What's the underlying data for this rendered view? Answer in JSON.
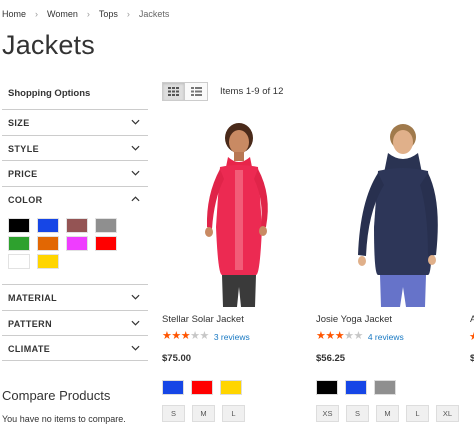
{
  "breadcrumb": {
    "items": [
      "Home",
      "Women",
      "Tops"
    ],
    "current": "Jackets",
    "separator": "›"
  },
  "page_title": "Jackets",
  "sidebar": {
    "title": "Shopping Options",
    "filters": [
      "SIZE",
      "STYLE",
      "PRICE",
      "COLOR",
      "MATERIAL",
      "PATTERN",
      "CLIMATE"
    ],
    "color_swatches": [
      "#000000",
      "#1646e6",
      "#945454",
      "#8f8f8f",
      "#2ea12e",
      "#e26703",
      "#ef3dff",
      "#ff0000",
      "#ffffff",
      "#ffd500"
    ]
  },
  "compare": {
    "title": "Compare Products",
    "empty_text": "You have no items to compare."
  },
  "toolbar": {
    "amount": "Items 1-9 of 12",
    "grid_icon": "grid-icon",
    "list_icon": "list-icon"
  },
  "products": [
    {
      "name": "Stellar Solar Jacket",
      "rating_stars": 3,
      "reviews": "3 reviews",
      "price": "$75.00",
      "colors": [
        "#1646e6",
        "#ff0000",
        "#ffd500"
      ],
      "sizes": [
        "S",
        "M",
        "L"
      ]
    },
    {
      "name": "Josie Yoga Jacket",
      "rating_stars": 3,
      "reviews": "4 reviews",
      "price": "$56.25",
      "colors": [
        "#000000",
        "#1646e6",
        "#8f8f8f"
      ],
      "sizes": [
        "XS",
        "S",
        "M",
        "L",
        "XL"
      ]
    }
  ],
  "peek_product": {
    "name": "A",
    "price": "$"
  },
  "colors": {
    "accent_link": "#1979c3",
    "star": "#ff5501",
    "divider": "#cccccc"
  }
}
